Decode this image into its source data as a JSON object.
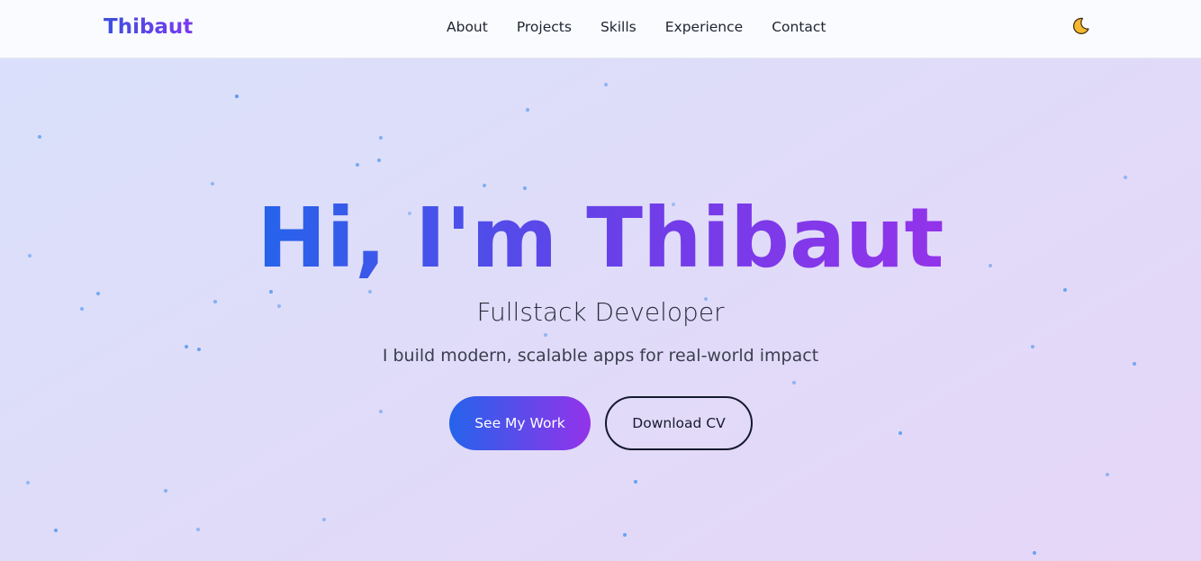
{
  "nav": {
    "brand": "Thibaut",
    "links": [
      "About",
      "Projects",
      "Skills",
      "Experience",
      "Contact"
    ],
    "theme_icon": "moon-icon"
  },
  "hero": {
    "title": "Hi, I'm Thibaut",
    "subtitle": "Fullstack Developer",
    "tagline": "I build modern, scalable apps for real-world impact",
    "primary_button": "See My Work",
    "secondary_button": "Download CV"
  },
  "colors": {
    "gradient_start": "#2563eb",
    "gradient_end": "#9333ea",
    "background_start": "#d9e1fb",
    "background_end": "#e6d6f8",
    "particle": "#5b9bf0"
  }
}
